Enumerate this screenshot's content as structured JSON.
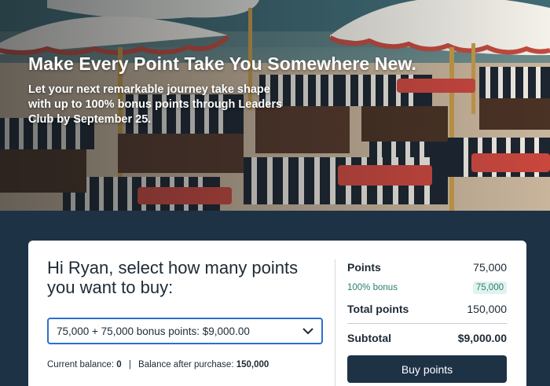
{
  "hero": {
    "title": "Make Every Point Take You Somewhere New.",
    "subtitle": "Let your next remarkable journey take shape with up to 100% bonus points through Leaders Club by September 25."
  },
  "purchase": {
    "greeting": "Hi Ryan, select how many points you want to buy:",
    "selected_option": "75,000 + 75,000 bonus points: $9,000.00",
    "chevron_icon": "chevron-down-icon",
    "current_balance_label": "Current balance:",
    "current_balance_value": "0",
    "separator": "|",
    "after_purchase_label": "Balance after purchase:",
    "after_purchase_value": "150,000"
  },
  "summary": {
    "points_label": "Points",
    "points_value": "75,000",
    "bonus_label": "100% bonus",
    "bonus_value": "75,000",
    "total_label": "Total points",
    "total_value": "150,000",
    "subtotal_label": "Subtotal",
    "subtotal_value": "$9,000.00",
    "buy_label": "Buy points"
  },
  "colors": {
    "navy": "#1e3246",
    "accent_blue": "#2b6fd3",
    "bonus_teal": "#2c7d72",
    "bonus_bg": "#e1f3ef"
  }
}
